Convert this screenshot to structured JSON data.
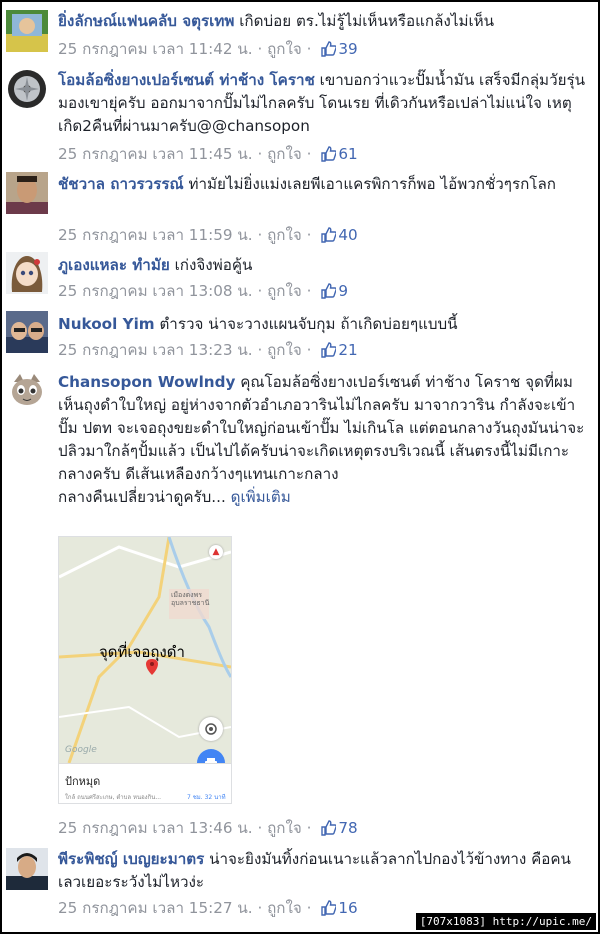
{
  "comments": [
    {
      "name": "ยิ่งลักษณ์แฟนคลับ จตุรเทพ",
      "text": "เกิดบ่อย ตร.ไม่รู้ไม่เห็นหรือแกล้งไม่เห็น",
      "date": "25 กรกฎาคม เวลา 11:42 น.",
      "like_label": "ถูกใจ",
      "likes": "39"
    },
    {
      "name": "โอมล้อซิ่งยางเปอร์เซนต์ ท่าช้าง โคราช",
      "text": "เขาบอกว่าแวะปั๊มน้ำมัน เสร็จมีกลุ่มวัยรุ่นมองเขายุ่ครับ ออกมาจากปั๊มไม่ไกลครับ โดนเรย ที่เดิวกันหรือเปล่าไม่แน่ใจ เหตุเกิด2คืนที่ผ่านมาครับ@@chansopon",
      "date": "25 กรกฎาคม เวลา 11:45 น.",
      "like_label": "ถูกใจ",
      "likes": "61"
    },
    {
      "name": "ชัชวาล ถาวรวรรณ์",
      "text": "ท่ามัยไม่ยิ่งแม่งเลยพีเอาแครพิการก็พอ ไอ้พวกชั่วๆรกโลก",
      "date": "25 กรกฎาคม เวลา 11:59 น.",
      "like_label": "ถูกใจ",
      "likes": "40"
    },
    {
      "name": "ภูเองแหละ ทำมัย",
      "text": "เก่งจิงพ่อคู้น",
      "date": "25 กรกฎาคม เวลา 13:08 น.",
      "like_label": "ถูกใจ",
      "likes": "9"
    },
    {
      "name": "Nukool Yim",
      "text": "ตำรวจ น่าจะวางแผนจับกุม ถ้าเกิดบ่อยๆแบบนี้",
      "date": "25 กรกฎาคม เวลา 13:23 น.",
      "like_label": "ถูกใจ",
      "likes": "21"
    },
    {
      "name": "Chansopon Wowlndy",
      "text": "คุณโอมล้อซิ่งยางเปอร์เซนต์ ท่าช้าง โคราช จุดที่ผมเห็นถุงดำใบใหญ่ อยู่ห่างจากตัวอำเภอวารินไม่ไกลครับ มาจากวาริน กำลังจะเข้าปั๊ม ปตท จะเจอถุงขยะดำใบใหญ่ก่อนเข้าปั๊ม ไม่เกินโล แต่ตอนกลางวันถุงมันน่าจะปลิวมาใกล้ๆปั้มแล้ว เป็นไปได้ครับน่าจะเกิดเหตุตรงบริเวณนี้ เส้นตรงนี้ไม่มีเกาะกลางครับ ดีเส้นเหลืองกว้างๆแทนเกาะกลาง",
      "text2": "กลางคืนเปลี่ยวน่าดูครับ...",
      "see_more": "ดูเพิ่มเติม",
      "date": "25 กรกฎาคม เวลา 13:46 น.",
      "like_label": "ถูกใจ",
      "likes": "78",
      "map": {
        "pin_label": "จุดที่เจอถุงดำ",
        "map_text": "เมืองตงพร อุบลราชธานี",
        "logo": "Google",
        "place_title": "ปักหมุด",
        "place_sub": "ใกล้ ถนนศรีสะเกษ, ตำบล หนองกิน...",
        "drive_time": "7 ชม. 32 นาที"
      }
    },
    {
      "name": "พีระพิชญ์ เบญยะมาตร",
      "text": "น่าจะยิงมันทิ้งก่อนเนาะแล้วลากไปกองไว้ข้างทาง คือคนเลวเยอะระวังไม่ไหวง่ะ",
      "date": "25 กรกฎาคม เวลา 15:27 น.",
      "like_label": "ถูกใจ",
      "likes": "16"
    }
  ],
  "watermark": "[707x1083] http://upic.me/",
  "colors": {
    "name": "#365899",
    "meta": "#90949c",
    "likes": "#4267b2",
    "text": "#1d2129"
  }
}
